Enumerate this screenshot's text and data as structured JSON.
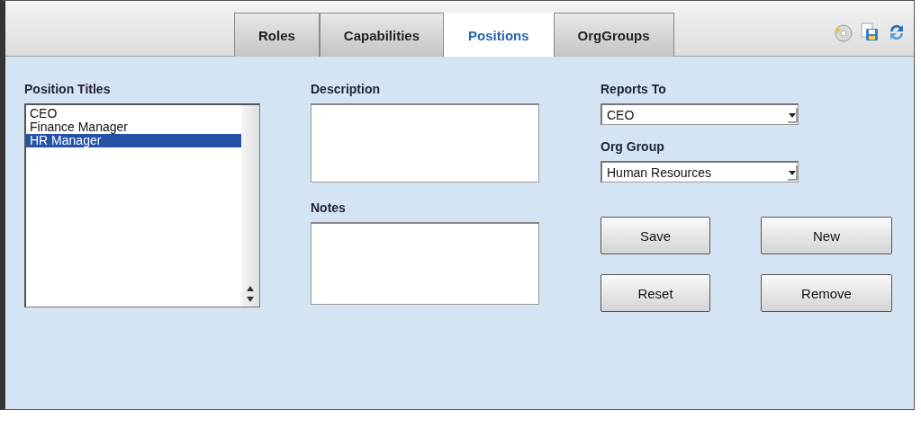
{
  "tabs": [
    {
      "label": "Roles",
      "selected": false
    },
    {
      "label": "Capabilities",
      "selected": false
    },
    {
      "label": "Positions",
      "selected": true
    },
    {
      "label": "OrgGroups",
      "selected": false
    }
  ],
  "position_titles": {
    "label": "Position Titles",
    "items": [
      {
        "label": "CEO",
        "selected": false
      },
      {
        "label": "Finance Manager",
        "selected": false
      },
      {
        "label": "HR Manager",
        "selected": true
      }
    ]
  },
  "description": {
    "label": "Description"
  },
  "notes": {
    "label": "Notes"
  },
  "reports_to": {
    "label": "Reports To",
    "value": "CEO"
  },
  "org_group": {
    "label": "Org Group",
    "value": "Human Resources"
  },
  "buttons": [
    "Save",
    "New",
    "Reset",
    "Remove"
  ]
}
